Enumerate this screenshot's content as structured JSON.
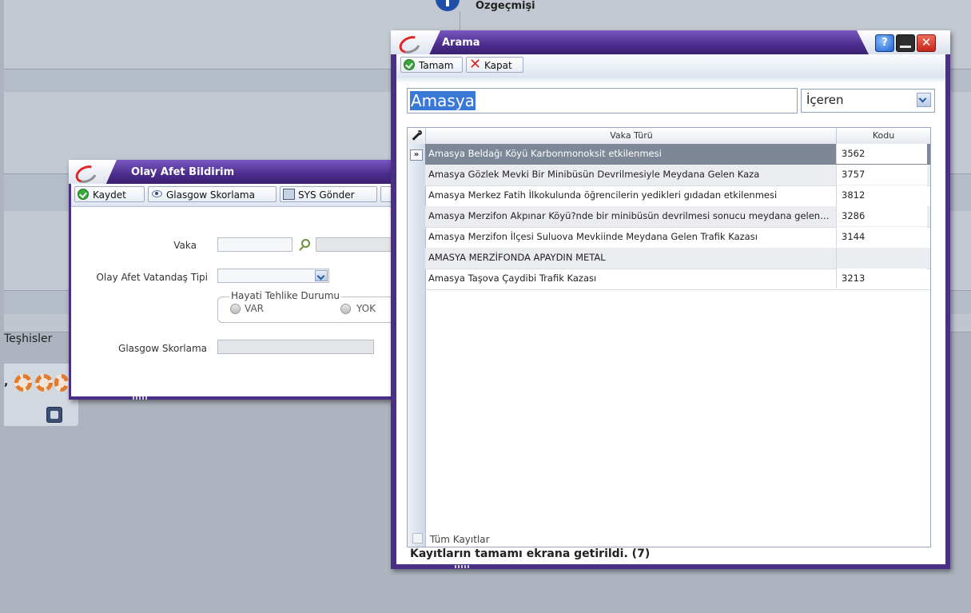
{
  "background": {
    "header_title": "Özgeçmişi",
    "diagnoses_label": "Teşhisler",
    "diagnoses_icon": "report-icon"
  },
  "olay_window": {
    "title": "Olay Afet Bildirim",
    "toolbar": {
      "save_label": "Kaydet",
      "glasgow_label": "Glasgow Skorlama",
      "sys_label": "SYS Gönder"
    },
    "form": {
      "vaka_label": "Vaka",
      "vaka_value": "",
      "citizen_type_label": "Olay Afet Vatandaş Tipi",
      "citizen_type_value": "",
      "life_danger_legend": "Hayati Tehlike Durumu",
      "radio_var": "VAR",
      "radio_yok": "YOK",
      "glasgow_label": "Glasgow Skorlama",
      "glasgow_value": ""
    }
  },
  "arama_window": {
    "title": "Arama",
    "toolbar": {
      "ok_label": "Tamam",
      "close_label": "Kapat"
    },
    "window_controls": {
      "help": "?",
      "close": "✕"
    },
    "search": {
      "value": "Amasya",
      "match_mode": "İçeren"
    },
    "grid": {
      "columns": [
        "Vaka Türü",
        "Kodu"
      ],
      "selected_marker": "»",
      "rows": [
        {
          "name": "Amasya Beldağı Köyü Karbonmonoksit etkilenmesi",
          "code": "3562"
        },
        {
          "name": "Amasya Gözlek Mevki Bir Minibüsün Devrilmesiyle Meydana Gelen Kaza",
          "code": "3757"
        },
        {
          "name": "Amasya Merkez Fatih İlkokulunda öğrencilerin yedikleri gıdadan etkilenmesi",
          "code": "3812"
        },
        {
          "name": "Amasya Merzifon Akpınar Köyü?nde bir minibüsün devrilmesi sonucu meydana gelen kaza",
          "code": "3286"
        },
        {
          "name": "Amasya Merzifon İlçesi Suluova Mevkiinde Meydana Gelen Trafik Kazası",
          "code": "3144"
        },
        {
          "name": "AMASYA MERZİFONDA APAYDIN METAL",
          "code": ""
        },
        {
          "name": "Amasya Taşova Çaydibi Trafik Kazası",
          "code": "3213"
        }
      ]
    },
    "all_records_label": "Tüm Kayıtlar",
    "status": "Kayıtların tamamı ekrana getirildi. (7)"
  }
}
